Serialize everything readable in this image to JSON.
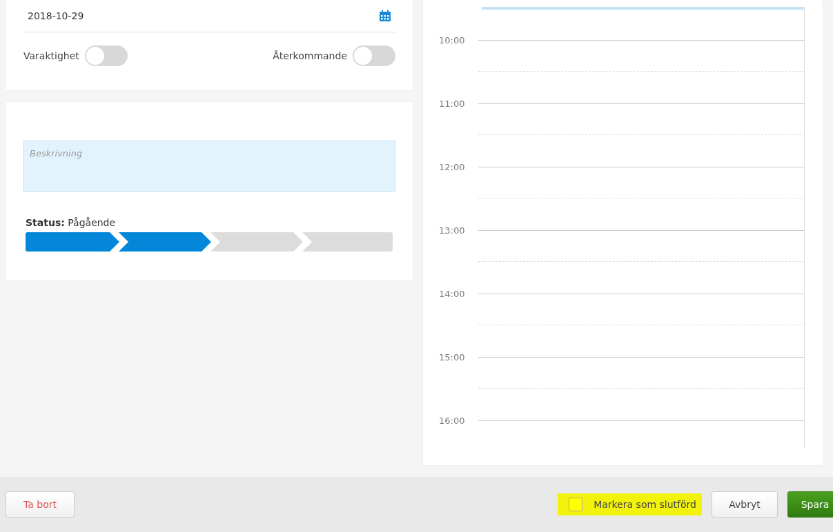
{
  "date_field": {
    "value": "2018-10-29"
  },
  "toggles": [
    {
      "label": "Varaktighet",
      "on": false
    },
    {
      "label": "Återkommande",
      "on": false
    }
  ],
  "description": {
    "placeholder": "Beskrivning"
  },
  "status": {
    "label": "Status:",
    "value": "Pågående",
    "steps": [
      {
        "done": true
      },
      {
        "done": true
      },
      {
        "done": false
      },
      {
        "done": false
      }
    ]
  },
  "calendar": {
    "hours": [
      "10:00",
      "11:00",
      "12:00",
      "13:00",
      "14:00",
      "15:00",
      "16:00"
    ]
  },
  "footer": {
    "delete": "Ta bort",
    "mark_done": {
      "label": "Markera som slutförd",
      "checked": false,
      "highlighted": true
    },
    "cancel": "Avbryt",
    "save": "Spara"
  }
}
